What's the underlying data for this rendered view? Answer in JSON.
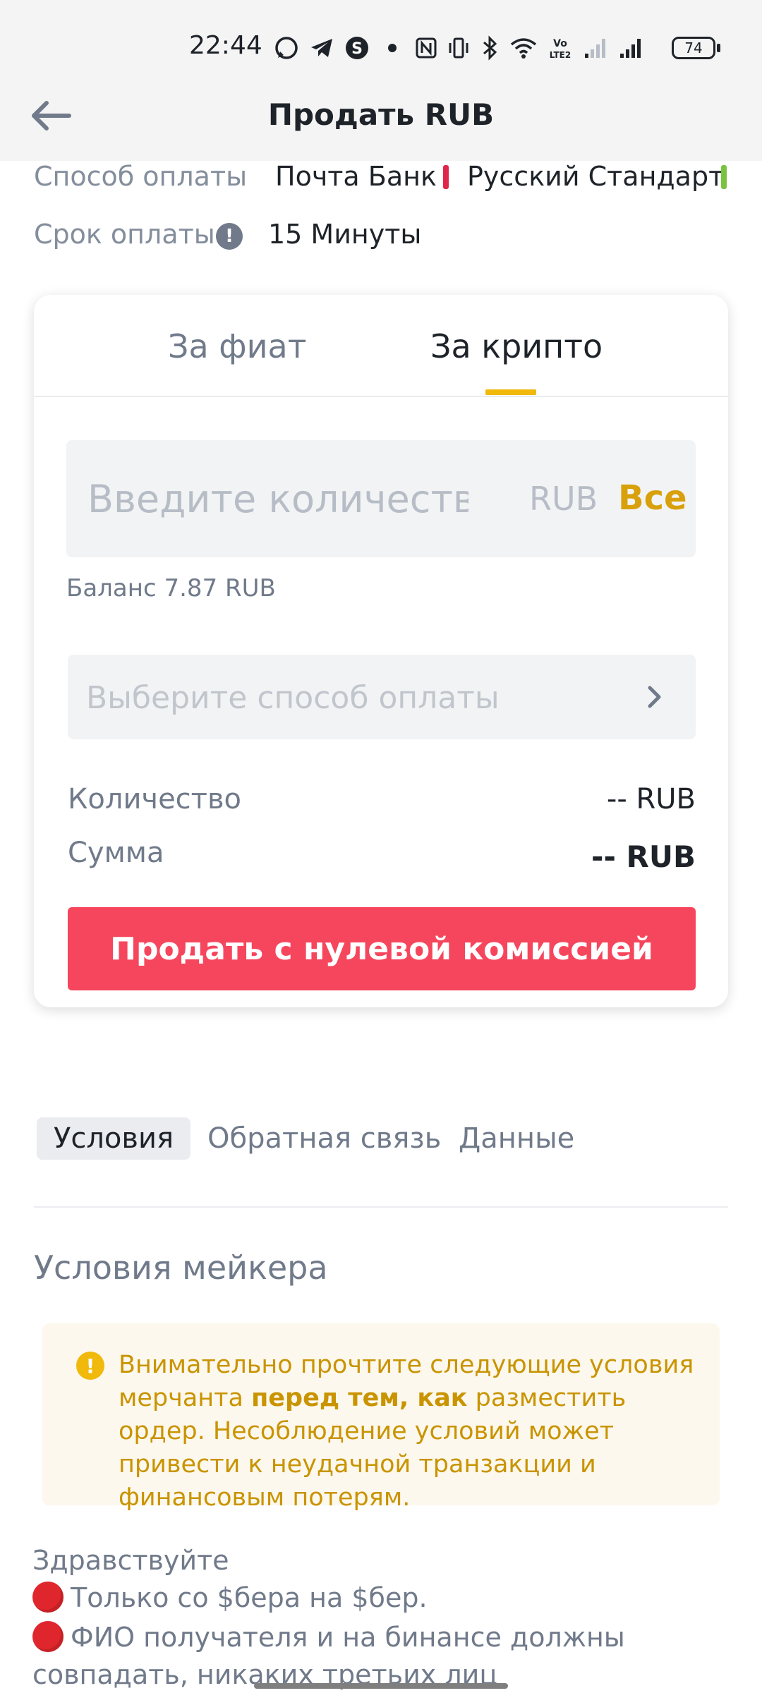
{
  "status_bar": {
    "time": "22:44",
    "battery": "74",
    "network_label": "VoLTE2",
    "icons": [
      "whatsapp-icon",
      "telegram-icon",
      "skype-icon",
      "dot-icon",
      "nfc-icon",
      "vibrate-icon",
      "bluetooth-icon",
      "wifi-icon",
      "volte-icon",
      "signal-icon",
      "signal-icon",
      "battery-icon"
    ]
  },
  "header": {
    "title": "Продать RUB",
    "back_icon": "arrow-left-icon"
  },
  "info": {
    "payment_label": "Способ оплаты",
    "payment_methods": [
      {
        "name": "Почта Банк",
        "color": "#e0274b"
      },
      {
        "name": "Русский Стандарт",
        "color": "#7cc242"
      }
    ],
    "time_label": "Срок оплаты",
    "time_icon": "!",
    "time_value": "15 Минуты"
  },
  "card": {
    "tabs": [
      "За фиат",
      "За крипто"
    ],
    "active_tab": "За крипто",
    "amount_placeholder": "Введите количество",
    "amount_unit": "RUB",
    "amount_all": "Все",
    "balance": "Баланс 7.87 RUB",
    "payment_placeholder": "Выберите способ оплаты",
    "quantity_label": "Количество",
    "quantity_value": "-- RUB",
    "sum_label": "Сумма",
    "sum_value": "-- RUB",
    "sell_button": "Продать с нулевой комиссией"
  },
  "sub_tabs": [
    "Условия",
    "Обратная связь",
    "Данные"
  ],
  "terms": {
    "title": "Условия мейкера",
    "warning_icon": "!",
    "warning_part1": "Внимательно прочтите следующие условия мерчанта ",
    "warning_bold": "перед тем, как",
    "warning_part2": " разместить ордер. Несоблюдение условий может привести к неудачной транзакции и финансовым потерям.",
    "lines": [
      "Здравствуйте",
      "Только со $бера на $бер.",
      "ФИО получателя и на бинансе должны",
      "совпадать, никаких третьих лиц"
    ]
  },
  "colors": {
    "accent": "#f0b90b",
    "sell": "#f6465d",
    "all_link": "#d8a10b",
    "warning_text": "#c99400",
    "warning_bg": "#fdf8ee"
  }
}
